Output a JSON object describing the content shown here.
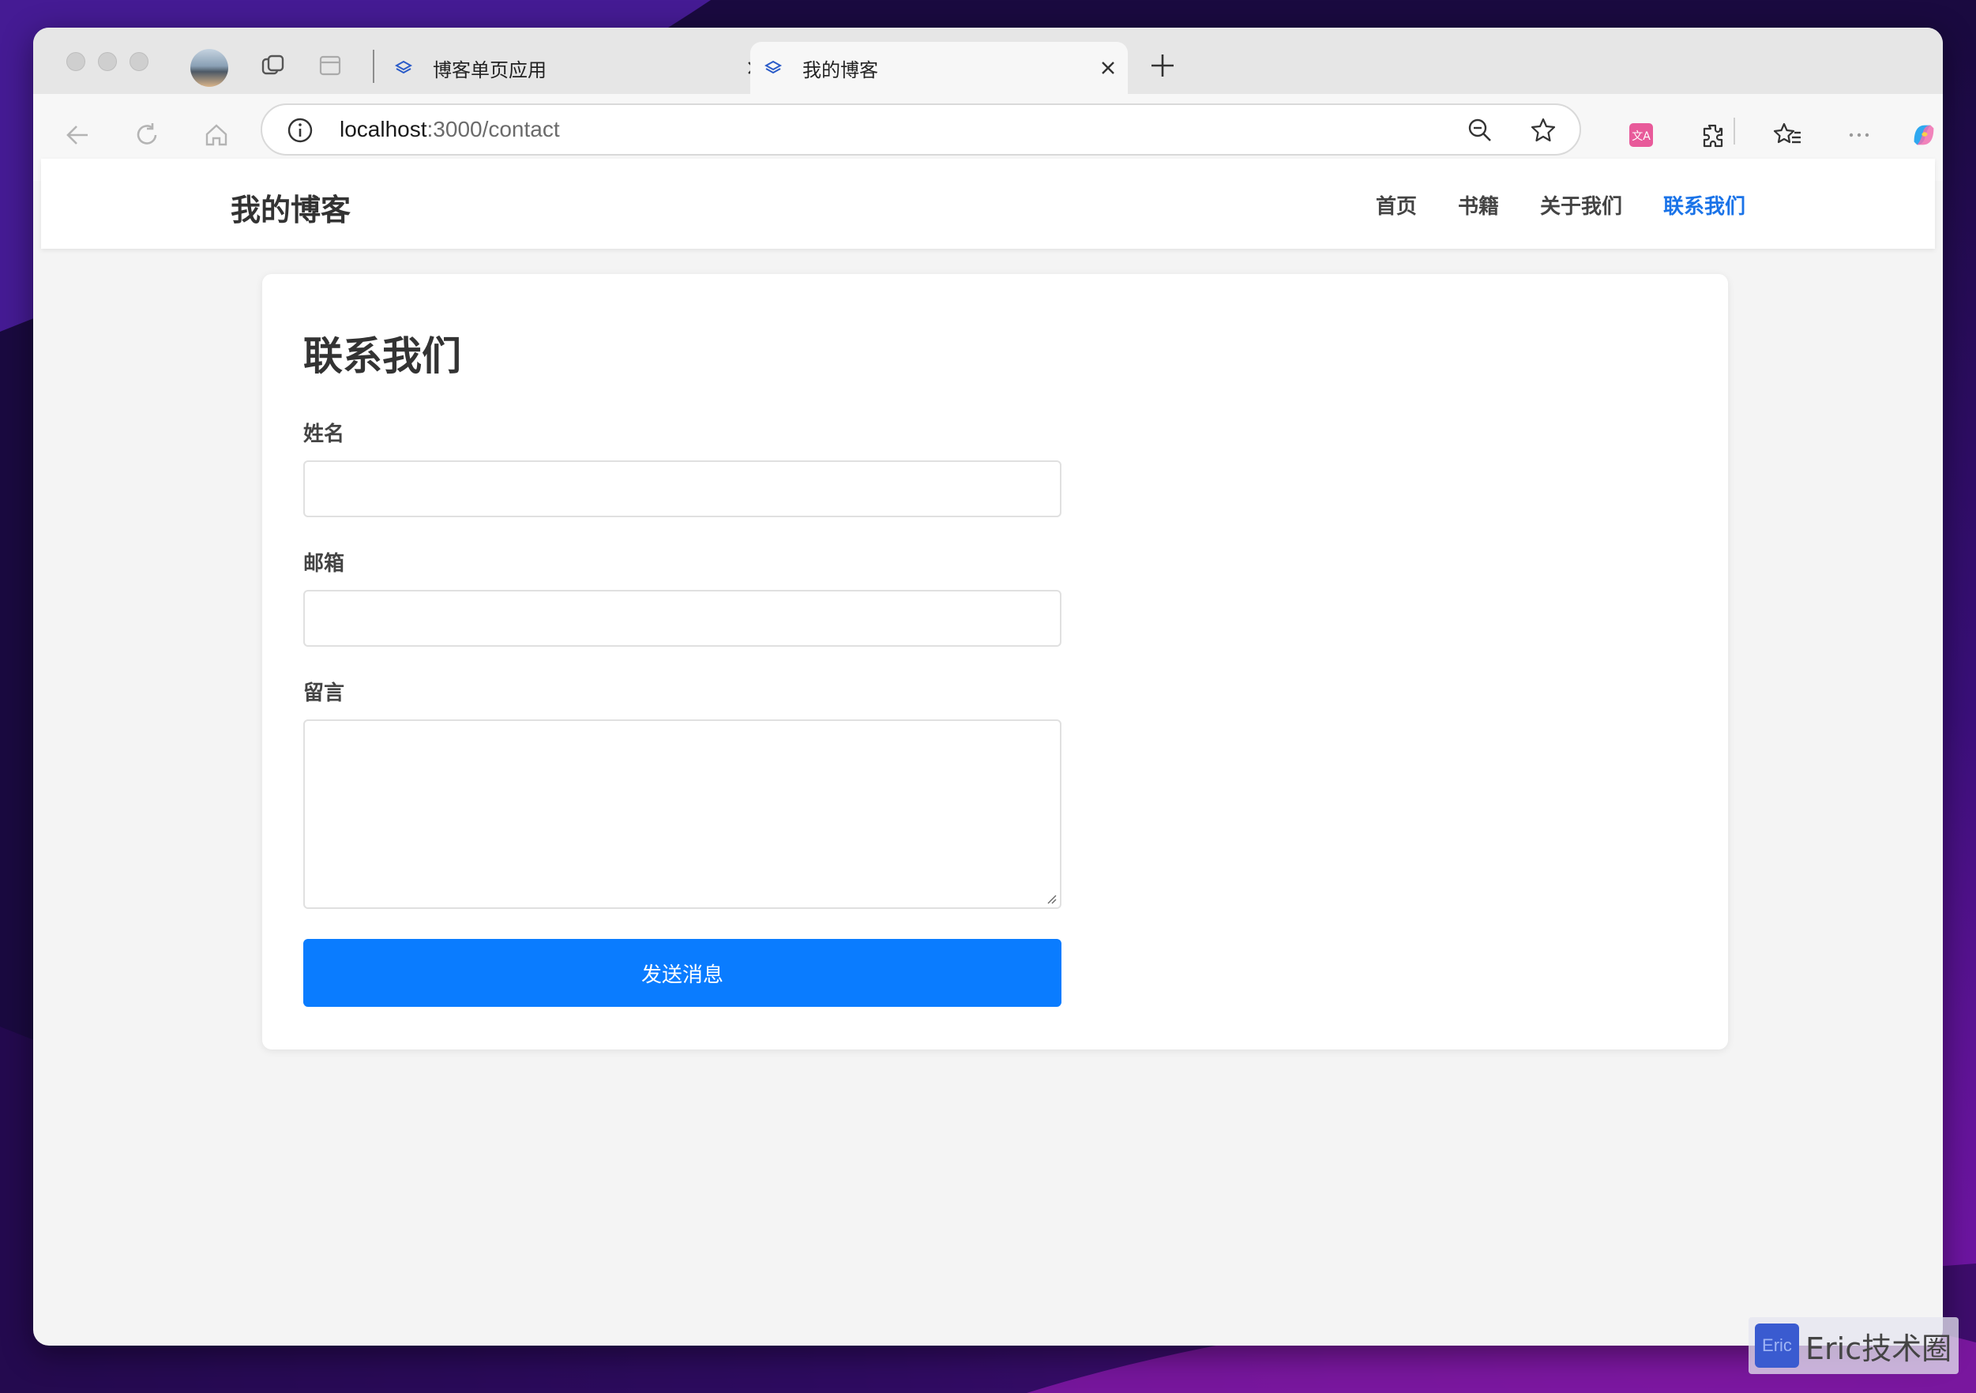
{
  "browser": {
    "tabs": [
      {
        "title": "博客单页应用",
        "active": false
      },
      {
        "title": "我的博客",
        "active": true
      }
    ],
    "address": {
      "host": "localhost",
      "path": ":3000/contact"
    }
  },
  "site": {
    "brand": "我的博客",
    "nav": [
      {
        "label": "首页",
        "active": false
      },
      {
        "label": "书籍",
        "active": false
      },
      {
        "label": "关于我们",
        "active": false
      },
      {
        "label": "联系我们",
        "active": true
      }
    ]
  },
  "contact": {
    "title": "联系我们",
    "fields": {
      "name_label": "姓名",
      "name_value": "",
      "email_label": "邮箱",
      "email_value": "",
      "message_label": "留言",
      "message_value": ""
    },
    "submit_label": "发送消息"
  },
  "watermark": {
    "logo": "Eric",
    "text": "Eric技术圈"
  },
  "colors": {
    "accent": "#0a7cff",
    "nav_active": "#1a73e8"
  },
  "icons": [
    "back-icon",
    "refresh-icon",
    "home-icon",
    "info-icon",
    "zoom-out-icon",
    "favorite-star-icon",
    "translate-icon",
    "extensions-icon",
    "favorites-icon",
    "more-icon",
    "copilot-icon",
    "tab-actions-icon",
    "vertical-tabs-icon",
    "new-tab-icon",
    "close-tab-icon"
  ]
}
